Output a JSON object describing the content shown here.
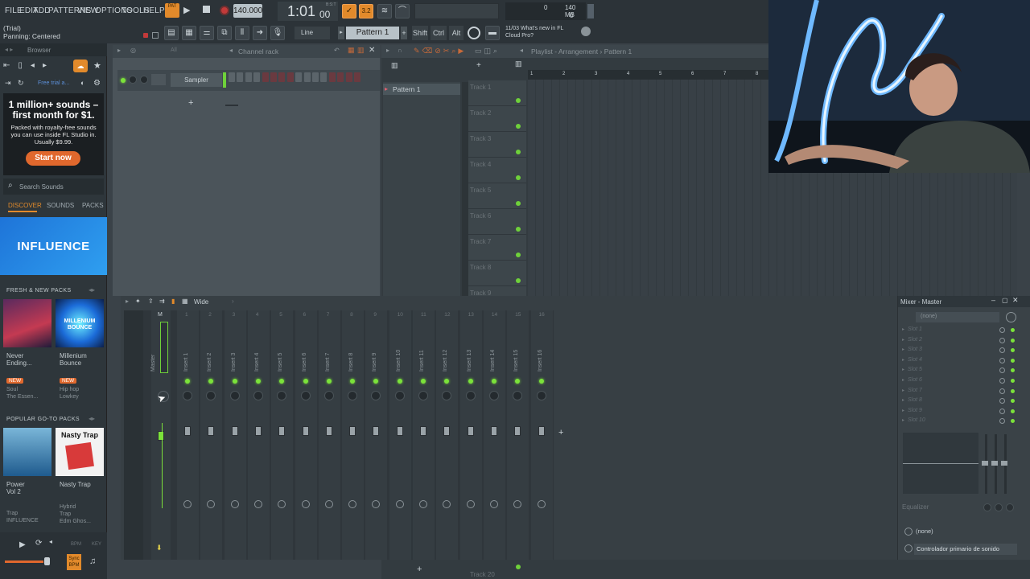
{
  "menu": {
    "items": [
      "FILE",
      "EDIT",
      "ADD",
      "PATTERNS",
      "VIEW",
      "OPTIONS",
      "TOOLS",
      "HELP"
    ],
    "pat_label": "PAT",
    "tempo": "140.000",
    "time": "1:01",
    "time_sub": "00",
    "time_unit": "B:S:T",
    "cpu_value": "0",
    "mem_label": "140 MB",
    "mem_sub": "0"
  },
  "hint": {
    "line1": "(Trial)",
    "line2": "Panning: Centered"
  },
  "toolbar2": {
    "snap": "Line",
    "pattern": "Pattern 1",
    "shift": "Shift",
    "ctrl": "Ctrl",
    "alt": "Alt",
    "news_date": "11/03",
    "news_text": "What's new in FL",
    "news_text2": "Cloud Pro?"
  },
  "browser": {
    "title": "Browser",
    "free_trial": "Free trial a...",
    "ad_title": "1 million+ sounds – first month for $1.",
    "ad_sub": "Packed with royalty-free sounds you can use inside FL Studio in. Usually $9.99.",
    "start_now": "Start now",
    "search_placeholder": "Search Sounds",
    "tabs": [
      "DISCOVER",
      "SOUNDS",
      "PACKS"
    ],
    "banner": "INFLUENCE",
    "fresh_head": "FRESH & NEW PACKS",
    "packs_fresh": [
      {
        "name1": "Never",
        "name2": "Ending...",
        "tag": "NEW",
        "genre": "Soul",
        "author": "The Essen..."
      },
      {
        "name1": "Millenium",
        "name2": "Bounce",
        "tag": "NEW",
        "genre": "Hip hop",
        "author": "Lowkey"
      }
    ],
    "popular_head": "POPULAR GO-TO PACKS",
    "packs_popular": [
      {
        "name1": "Power",
        "name2": "Vol 2",
        "genre": "Trap",
        "author": "INFLUENCE"
      },
      {
        "name1": "Nasty Trap",
        "name2": "",
        "genre": "Hybrid",
        "genre2": "Trap",
        "author": "Edm Ghos..."
      }
    ],
    "cover_text_nasty": "Nasty Trap",
    "cover_text_mb": "MILLENIUM BOUNCE",
    "footer_bpm": "BPM",
    "footer_key": "KEY",
    "footer_sync": "Sync BPM"
  },
  "channel_rack": {
    "title": "Channel rack",
    "filter": "All",
    "channel": "Sampler",
    "steps": 16
  },
  "playlist": {
    "title": "Playlist - Arrangement › Pattern 1",
    "pattern_item": "Pattern 1",
    "tracks": [
      "Track 1",
      "Track 2",
      "Track 3",
      "Track 4",
      "Track 5",
      "Track 6",
      "Track 7",
      "Track 8",
      "Track 9"
    ],
    "bars": [
      "1",
      "2",
      "3",
      "4",
      "5",
      "6",
      "7",
      "8"
    ],
    "bottom_track": "Track 20"
  },
  "mixer": {
    "view": "Wide",
    "master": "Master",
    "inserts": [
      "Insert 1",
      "Insert 2",
      "Insert 3",
      "Insert 4",
      "Insert 5",
      "Insert 6",
      "Insert 7",
      "Insert 8",
      "Insert 9",
      "Insert 10",
      "Insert 11",
      "Insert 12",
      "Insert 13",
      "Insert 14",
      "Insert 15",
      "Insert 16"
    ],
    "numbers": [
      "1",
      "2",
      "3",
      "4",
      "5",
      "6",
      "7",
      "8",
      "9",
      "10",
      "11",
      "12",
      "13",
      "14",
      "15",
      "16"
    ],
    "master_num": "M"
  },
  "mixer_panel": {
    "title": "Mixer - Master",
    "input": "(none)",
    "slots": [
      "Slot 1",
      "Slot 2",
      "Slot 3",
      "Slot 4",
      "Slot 5",
      "Slot 6",
      "Slot 7",
      "Slot 8",
      "Slot 9",
      "Slot 10"
    ],
    "equalizer": "Equalizer",
    "output": "(none)",
    "device": "Controlador primario de sonido"
  }
}
